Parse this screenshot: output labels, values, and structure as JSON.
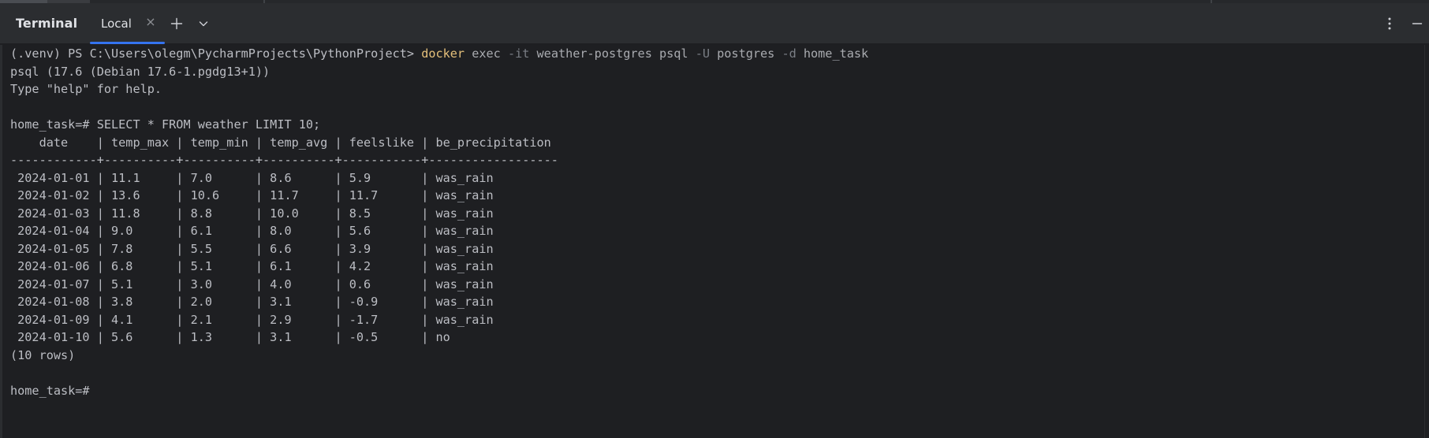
{
  "toolwindow": {
    "title": "Terminal",
    "tab_label": "Local",
    "close_glyph": "×",
    "icons": [
      "close-icon",
      "plus-icon",
      "chevron-down-icon",
      "more-vertical-icon"
    ],
    "accent_color": "#3574f0"
  },
  "terminal": {
    "prompt_line": {
      "prefix": "(.venv) PS C:\\Users\\olegm\\PycharmProjects\\PythonProject> ",
      "command": "docker",
      "args": [
        {
          "text": " exec ",
          "style": "val"
        },
        {
          "text": "-it",
          "style": "dim"
        },
        {
          "text": " weather-postgres psql ",
          "style": "val"
        },
        {
          "text": "-U",
          "style": "dim"
        },
        {
          "text": " postgres ",
          "style": "val"
        },
        {
          "text": "-d",
          "style": "dim"
        },
        {
          "text": " home_task",
          "style": "val"
        }
      ]
    },
    "psql_version": "psql (17.6 (Debian 17.6-1.pgdg13+1))",
    "help_hint": "Type \"help\" for help.",
    "query_line": "home_task=# SELECT * FROM weather LIMIT 10;",
    "table": {
      "header": "    date    | temp_max | temp_min | temp_avg | feelslike | be_precipitation ",
      "separator": "------------+----------+----------+----------+-----------+------------------",
      "columns": [
        "date",
        "temp_max",
        "temp_min",
        "temp_avg",
        "feelslike",
        "be_precipitation"
      ],
      "rows": [
        [
          "2024-01-01",
          "11.1",
          "7.0",
          "8.6",
          "5.9",
          "was_rain"
        ],
        [
          "2024-01-02",
          "13.6",
          "10.6",
          "11.7",
          "11.7",
          "was_rain"
        ],
        [
          "2024-01-03",
          "11.8",
          "8.8",
          "10.0",
          "8.5",
          "was_rain"
        ],
        [
          "2024-01-04",
          "9.0",
          "6.1",
          "8.0",
          "5.6",
          "was_rain"
        ],
        [
          "2024-01-05",
          "7.8",
          "5.5",
          "6.6",
          "3.9",
          "was_rain"
        ],
        [
          "2024-01-06",
          "6.8",
          "5.1",
          "6.1",
          "4.2",
          "was_rain"
        ],
        [
          "2024-01-07",
          "5.1",
          "3.0",
          "4.0",
          "0.6",
          "was_rain"
        ],
        [
          "2024-01-08",
          "3.8",
          "2.0",
          "3.1",
          "-0.9",
          "was_rain"
        ],
        [
          "2024-01-09",
          "4.1",
          "2.1",
          "2.9",
          "-1.7",
          "was_rain"
        ],
        [
          "2024-01-10",
          "5.6",
          "1.3",
          "3.1",
          "-0.5",
          "no"
        ]
      ]
    },
    "row_count": "(10 rows)",
    "final_prompt": "home_task=#"
  }
}
